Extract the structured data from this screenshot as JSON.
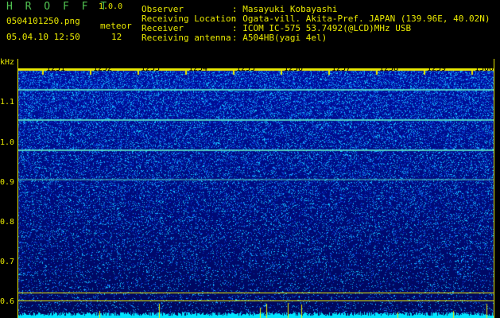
{
  "header": {
    "app_name": "H R O F F T",
    "app_version": "1.0.0",
    "file_name": "0504101250.png",
    "datetime": "05.04.10 12:50",
    "meteor_label": "meteor",
    "meteor_count": "12",
    "meta": [
      {
        "key": "Observer",
        "value": ": Masayuki Kobayashi"
      },
      {
        "key": "Receiving Location",
        "value": ": Ogata-vill. Akita-Pref. JAPAN (139.96E, 40.02N)"
      },
      {
        "key": "Receiver",
        "value": ": ICOM IC-575 53.7492(@LCD)MHz USB"
      },
      {
        "key": "Receiving antenna",
        "value": ": A504HB(yagi 4el)"
      }
    ]
  },
  "axes": {
    "y_unit": "kHz",
    "y_ticks": [
      "1.1",
      "1.0",
      "0.9",
      "0.8",
      "0.7",
      "0.6"
    ],
    "x_ticks": [
      "1251",
      "1252",
      "1253",
      "1254",
      "1255",
      "1256",
      "1257",
      "1258",
      "1259",
      "1300"
    ]
  },
  "colors": {
    "text_yellow": "#e8e800",
    "title_green": "#52c552",
    "spectro_bg": "#0a1a9a",
    "noise_cyan": "#00e6ff"
  }
}
